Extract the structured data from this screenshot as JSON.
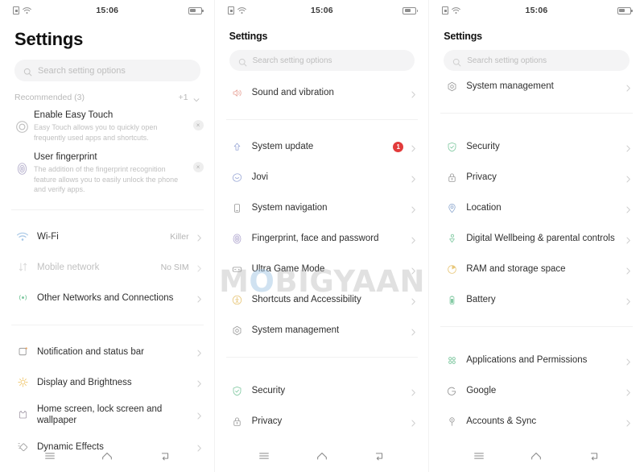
{
  "statusbar": {
    "time": "15:06",
    "sim_icon": "sim-card-icon",
    "wifi_icon": "wifi-icon",
    "battery_icon": "battery-icon"
  },
  "watermark": {
    "part1": "M",
    "part2": "O",
    "part3": "BIGYAAN"
  },
  "search": {
    "placeholder": "Search setting options",
    "icon": "search-icon"
  },
  "navbar": {
    "menu": "menu-icon",
    "home": "home-icon",
    "back": "back-icon"
  },
  "panel1": {
    "title": "Settings",
    "recommended": {
      "label": "Recommended (3)",
      "more": "+1",
      "chevron": "chevron-down-icon"
    },
    "recommendations": [
      {
        "icon": "easy-touch-icon",
        "title": "Enable Easy Touch",
        "desc": "Easy Touch allows you to quickly open frequently used apps and shortcuts.",
        "close": "×"
      },
      {
        "icon": "fingerprint-icon",
        "title": "User fingerprint",
        "desc": "The addition of the fingerprint recognition feature allows you to easily unlock the phone and verify apps.",
        "close": "×"
      }
    ],
    "groups": [
      {
        "items": [
          {
            "icon": "wifi-icon",
            "label": "Wi-Fi",
            "value": "Killer",
            "disabled": false
          },
          {
            "icon": "mobile-network-icon",
            "label": "Mobile network",
            "value": "No SIM",
            "disabled": true
          },
          {
            "icon": "other-networks-icon",
            "label": "Other Networks and Connections",
            "value": "",
            "disabled": false
          }
        ]
      },
      {
        "items": [
          {
            "icon": "notification-bar-icon",
            "label": "Notification and status bar",
            "value": "",
            "disabled": false
          },
          {
            "icon": "brightness-icon",
            "label": "Display and Brightness",
            "value": "",
            "disabled": false
          },
          {
            "icon": "wallpaper-icon",
            "label": "Home screen, lock screen and wallpaper",
            "value": "",
            "disabled": false
          },
          {
            "icon": "dynamic-effects-icon",
            "label": "Dynamic Effects",
            "value": "",
            "disabled": false
          }
        ]
      }
    ]
  },
  "panel2": {
    "title": "Settings",
    "groups": [
      {
        "items": [
          {
            "icon": "sound-icon",
            "label": "Sound and vibration",
            "badge": "",
            "value": ""
          }
        ]
      },
      {
        "items": [
          {
            "icon": "system-update-icon",
            "label": "System update",
            "badge": "1",
            "value": ""
          },
          {
            "icon": "jovi-icon",
            "label": "Jovi",
            "badge": "",
            "value": ""
          },
          {
            "icon": "system-navigation-icon",
            "label": "System navigation",
            "badge": "",
            "value": ""
          },
          {
            "icon": "fingerprint-icon",
            "label": "Fingerprint, face and password",
            "badge": "",
            "value": ""
          },
          {
            "icon": "game-mode-icon",
            "label": "Ultra Game Mode",
            "badge": "",
            "value": ""
          },
          {
            "icon": "accessibility-icon",
            "label": "Shortcuts and Accessibility",
            "badge": "",
            "value": ""
          },
          {
            "icon": "system-management-icon",
            "label": "System management",
            "badge": "",
            "value": ""
          }
        ]
      },
      {
        "items": [
          {
            "icon": "security-icon",
            "label": "Security",
            "badge": "",
            "value": ""
          },
          {
            "icon": "privacy-icon",
            "label": "Privacy",
            "badge": "",
            "value": ""
          }
        ]
      }
    ]
  },
  "panel3": {
    "title": "Settings",
    "groups": [
      {
        "items": [
          {
            "icon": "system-management-icon",
            "label": "System management"
          }
        ]
      },
      {
        "items": [
          {
            "icon": "security-icon",
            "label": "Security"
          },
          {
            "icon": "privacy-icon",
            "label": "Privacy"
          },
          {
            "icon": "location-icon",
            "label": "Location"
          },
          {
            "icon": "digital-wellbeing-icon",
            "label": "Digital Wellbeing & parental controls"
          },
          {
            "icon": "ram-storage-icon",
            "label": "RAM and storage space"
          },
          {
            "icon": "battery-icon",
            "label": "Battery"
          }
        ]
      },
      {
        "items": [
          {
            "icon": "applications-icon",
            "label": "Applications and Permissions"
          },
          {
            "icon": "google-icon",
            "label": "Google"
          },
          {
            "icon": "accounts-sync-icon",
            "label": "Accounts & Sync"
          }
        ]
      }
    ]
  }
}
